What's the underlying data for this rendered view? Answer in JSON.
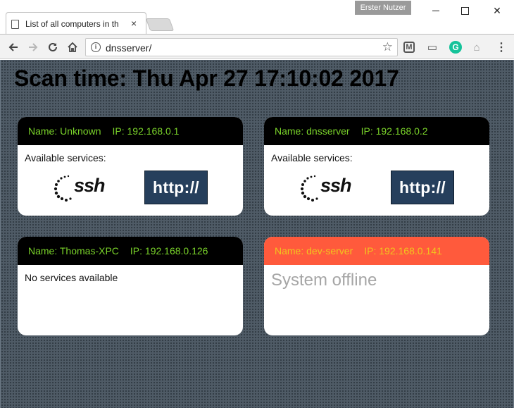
{
  "browser": {
    "profile_label": "Erster Nutzer",
    "tab_title": "List of all computers in th",
    "tab_close": "×",
    "url": "dnsserver/",
    "info_glyph": "i",
    "star_glyph": "☆",
    "minimize_label": "",
    "close_glyph": "✕"
  },
  "page": {
    "scan_title": "Scan time: Thu Apr 27 17:10:02 2017"
  },
  "colors": {
    "online_header_bg": "#000000",
    "online_header_text": "#7ad32a",
    "offline_header_bg": "#ff5a3c",
    "offline_header_text": "#f1c51e",
    "http_bg": "#263f5c",
    "page_bg": "#4f5b66"
  },
  "computers": [
    {
      "name": "Name: Unknown",
      "ip": "IP: 192.168.0.1",
      "status": "online",
      "services_label": "Available services:",
      "services": [
        "ssh",
        "http://"
      ]
    },
    {
      "name": "Name: dnsserver",
      "ip": "IP: 192.168.0.2",
      "status": "online",
      "services_label": "Available services:",
      "services": [
        "ssh",
        "http://"
      ]
    },
    {
      "name": "Name: Thomas-XPC",
      "ip": "IP: 192.168.0.126",
      "status": "online",
      "no_services_text": "No services available"
    },
    {
      "name": "Name: dev-server",
      "ip": "IP: 192.168.0.141",
      "status": "offline",
      "offline_text": "System offline"
    }
  ]
}
